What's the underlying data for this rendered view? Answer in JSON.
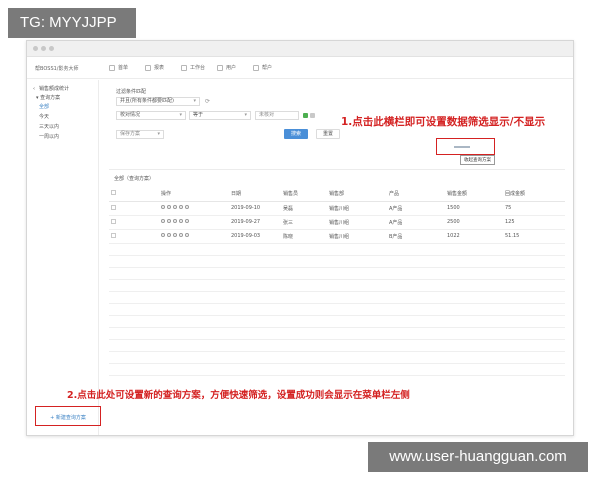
{
  "overlay": {
    "tg_label": "TG: MYYJJPP",
    "watermark": "www.user-huangguan.com"
  },
  "app": {
    "brand": "帮BOSS1/影务大师",
    "nav": [
      {
        "label": "首单",
        "icon": "home-icon"
      },
      {
        "label": "报表",
        "icon": "chart-icon"
      },
      {
        "label": "工作台",
        "icon": "briefcase-icon"
      },
      {
        "label": "用户",
        "icon": "user-icon"
      },
      {
        "label": "帮户",
        "icon": "account-icon"
      }
    ]
  },
  "sidebar": {
    "header": "销售额成统计",
    "section": "查询方案",
    "items": [
      "全部",
      "今天",
      "三天以内",
      "一周以内"
    ],
    "active_index": 0,
    "add_button": "+ 新建查询方案"
  },
  "filter": {
    "title": "过滤条件匹配",
    "match_mode": "并且(所有条件都要匹配)",
    "field": "校对情况",
    "operator": "等于",
    "value_placeholder": "未核对",
    "scheme_placeholder": "保存方案",
    "search_button": "搜索",
    "reset_button": "重置",
    "toggle_tooltip": "收起查询方案"
  },
  "annotations": {
    "note1": "1.点击此横栏即可设置数据筛选显示/不显示",
    "note2": "2.点击此处可设置新的查询方案，方便快速筛选，设置成功则会显示在菜单栏左侧"
  },
  "table": {
    "section_title": "全部（查询方案）",
    "columns": [
      "",
      "操作",
      "日期",
      "销售员",
      "销售部",
      "产品",
      "销售金额",
      "回成金额"
    ],
    "rows": [
      {
        "date": "2019-09-10",
        "salesperson": "吴磊",
        "dept": "销售川组",
        "product": "A产品",
        "amount": "1500",
        "collected": "75"
      },
      {
        "date": "2019-09-27",
        "salesperson": "张三",
        "dept": "销售川组",
        "product": "A产品",
        "amount": "2500",
        "collected": "125"
      },
      {
        "date": "2019-09-03",
        "salesperson": "陈晓",
        "dept": "销售川组",
        "product": "B产品",
        "amount": "1022",
        "collected": "51.15"
      }
    ]
  },
  "colors": {
    "accent": "#4a8fd8",
    "annotation": "#d42222"
  }
}
